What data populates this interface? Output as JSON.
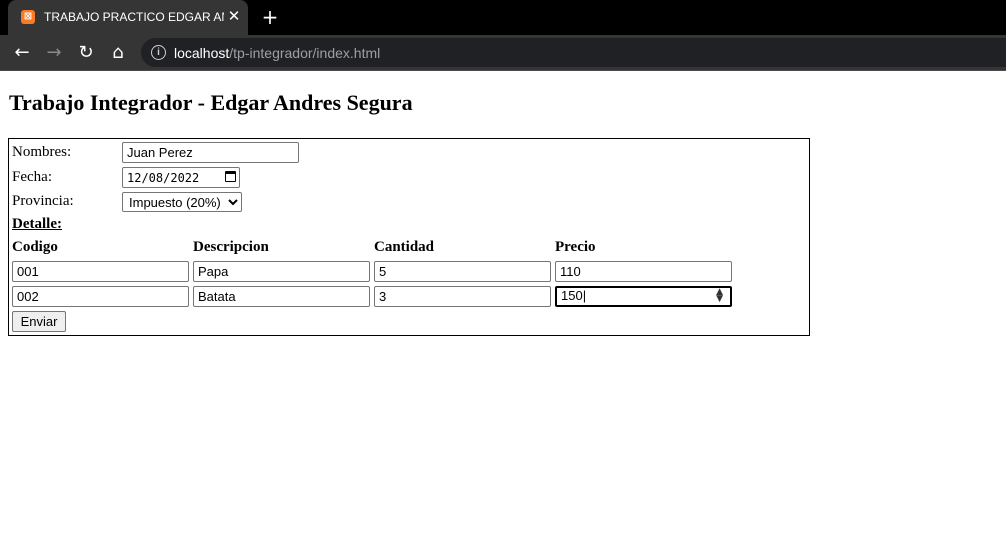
{
  "browser": {
    "tab_title": "TRABAJO PRACTICO EDGAR ANDRES SEGURA",
    "url_host": "localhost",
    "url_path": "/tp-integrador/index.html"
  },
  "page": {
    "heading": "Trabajo Integrador - Edgar Andres Segura"
  },
  "form": {
    "nombres_label": "Nombres:",
    "nombres_value": "Juan Perez",
    "fecha_label": "Fecha:",
    "fecha_value": "12/08/2022",
    "provincia_label": "Provincia:",
    "provincia_selected": "Impuesto (20%)",
    "detalle_label": "Detalle:",
    "columns": [
      "Codigo",
      "Descripcion",
      "Cantidad",
      "Precio"
    ],
    "rows": [
      {
        "codigo": "001",
        "descripcion": "Papa",
        "cantidad": "5",
        "precio": "110"
      },
      {
        "codigo": "002",
        "descripcion": "Batata",
        "cantidad": "3",
        "precio": "150"
      }
    ],
    "submit_label": "Enviar"
  }
}
